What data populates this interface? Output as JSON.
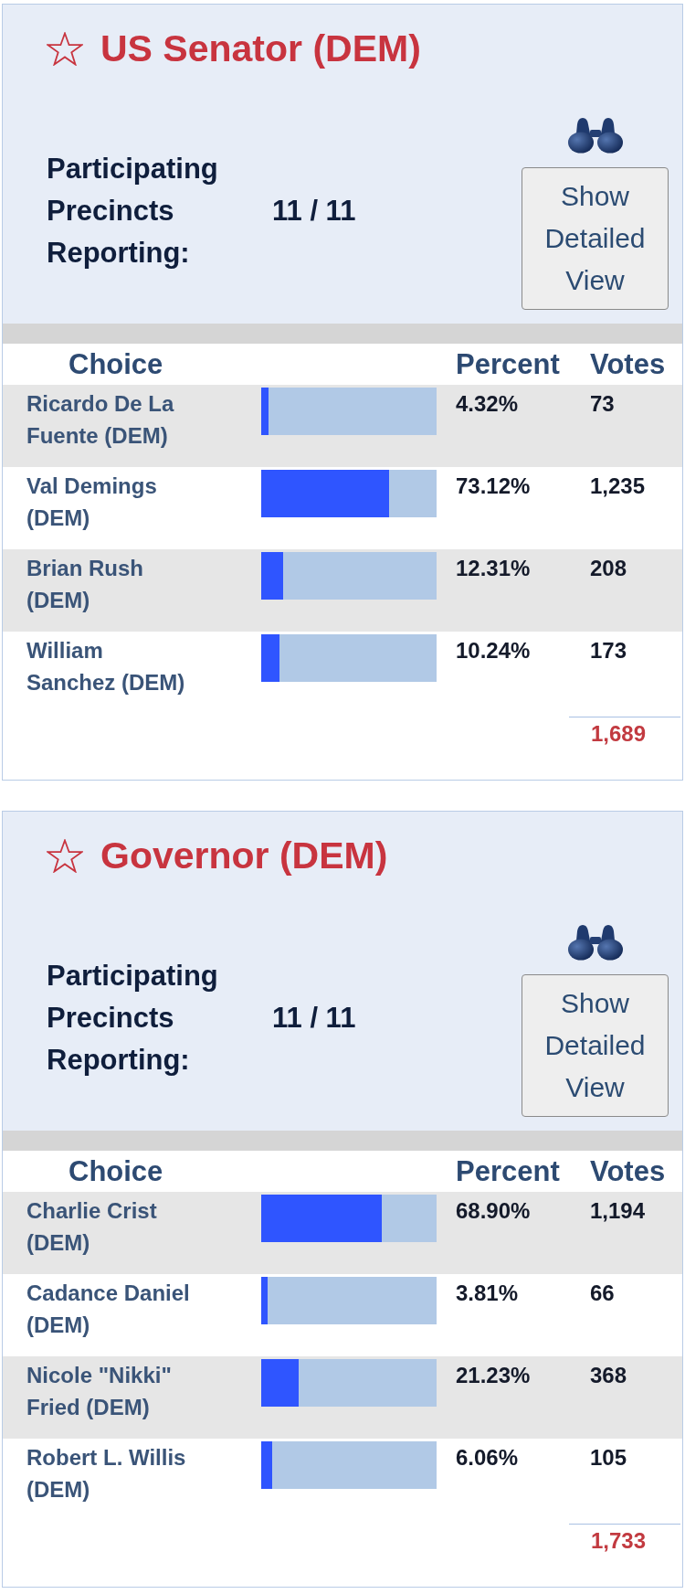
{
  "races": [
    {
      "title": "US Senator (DEM)",
      "favorite": false,
      "precincts_label": "Participating Precincts Reporting:",
      "precincts_value": "11 / 11",
      "detail_button": "Show Detailed View",
      "columns": [
        "Choice",
        "Percent",
        "Votes"
      ],
      "candidates": [
        {
          "name": "Ricardo De La Fuente (DEM)",
          "level": 0.0432,
          "percent": "4.32%",
          "votes": "73"
        },
        {
          "name": "Val Demings (DEM)",
          "level": 0.7312,
          "percent": "73.12%",
          "votes": "1,235"
        },
        {
          "name": "Brian Rush (DEM)",
          "level": 0.1231,
          "percent": "12.31%",
          "votes": "208"
        },
        {
          "name": "William Sanchez (DEM)",
          "level": 0.1024,
          "percent": "10.24%",
          "votes": "173"
        }
      ],
      "total": "1,689"
    },
    {
      "title": "Governor (DEM)",
      "favorite": false,
      "precincts_label": "Participating Precincts Reporting:",
      "precincts_value": "11 / 11",
      "detail_button": "Show Detailed View",
      "columns": [
        "Choice",
        "Percent",
        "Votes"
      ],
      "candidates": [
        {
          "name": "Charlie Crist (DEM)",
          "level": 0.689,
          "percent": "68.90%",
          "votes": "1,194"
        },
        {
          "name": "Cadance Daniel (DEM)",
          "level": 0.0381,
          "percent": "3.81%",
          "votes": "66"
        },
        {
          "name": "Nicole \"Nikki\" Fried (DEM)",
          "level": 0.2123,
          "percent": "21.23%",
          "votes": "368"
        },
        {
          "name": "Robert L. Willis (DEM)",
          "level": 0.0606,
          "percent": "6.06%",
          "votes": "105"
        }
      ],
      "total": "1,733"
    }
  ]
}
